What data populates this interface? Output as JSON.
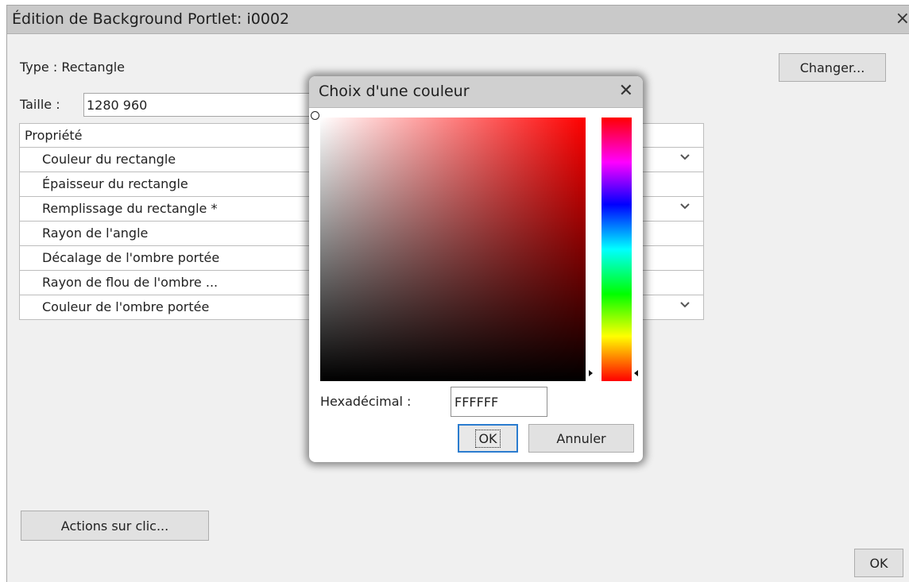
{
  "dialog": {
    "title": "Édition de Background Portlet: i0002",
    "close_glyph": "×",
    "type_label": "Type : Rectangle",
    "change_button": "Changer...",
    "size_label": "Taille :",
    "size_value": "1280 960",
    "actions_button": "Actions sur clic...",
    "ok_button": "OK"
  },
  "properties": {
    "header": "Propriété",
    "rows": [
      {
        "label": "Couleur du rectangle",
        "dropdown": true
      },
      {
        "label": "Épaisseur du rectangle",
        "dropdown": false
      },
      {
        "label": "Remplissage du rectangle  *",
        "dropdown": true
      },
      {
        "label": "Rayon de l'angle",
        "dropdown": false
      },
      {
        "label": "Décalage de l'ombre portée",
        "dropdown": false
      },
      {
        "label": "Rayon de flou de l'ombre ...",
        "dropdown": false
      },
      {
        "label": "Couleur de l'ombre portée",
        "dropdown": true
      }
    ]
  },
  "color_picker": {
    "title": "Choix d'une couleur",
    "close_glyph": "✕",
    "hex_label": "Hexadécimal :",
    "hex_value": "FFFFFF",
    "ok_button": "OK",
    "cancel_button": "Annuler",
    "base_hue_color": "#ff0000",
    "selection_color": "#FFFFFF"
  },
  "colors": {
    "dialog_bg": "#f0f0f0",
    "titlebar_bg": "#c9c9c9",
    "focus_border": "#2b7ccf"
  }
}
